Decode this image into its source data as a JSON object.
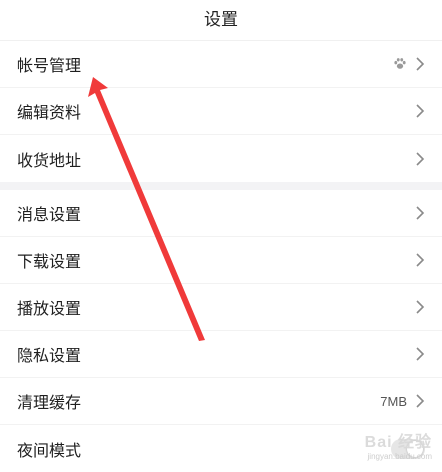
{
  "header": {
    "title": "设置"
  },
  "group1": [
    {
      "label": "帐号管理",
      "icon": "paw-icon"
    },
    {
      "label": "编辑资料"
    },
    {
      "label": "收货地址"
    }
  ],
  "group2": [
    {
      "label": "消息设置"
    },
    {
      "label": "下载设置"
    },
    {
      "label": "播放设置"
    },
    {
      "label": "隐私设置"
    },
    {
      "label": "清理缓存",
      "value": "7MB"
    },
    {
      "label": "夜间模式",
      "toggle": false
    }
  ],
  "watermark": {
    "text": "Bai 经验",
    "sub": "jingyan.baidu.com"
  },
  "colors": {
    "annotation_arrow": "#f03a3a",
    "separator": "#f3f3f5"
  }
}
